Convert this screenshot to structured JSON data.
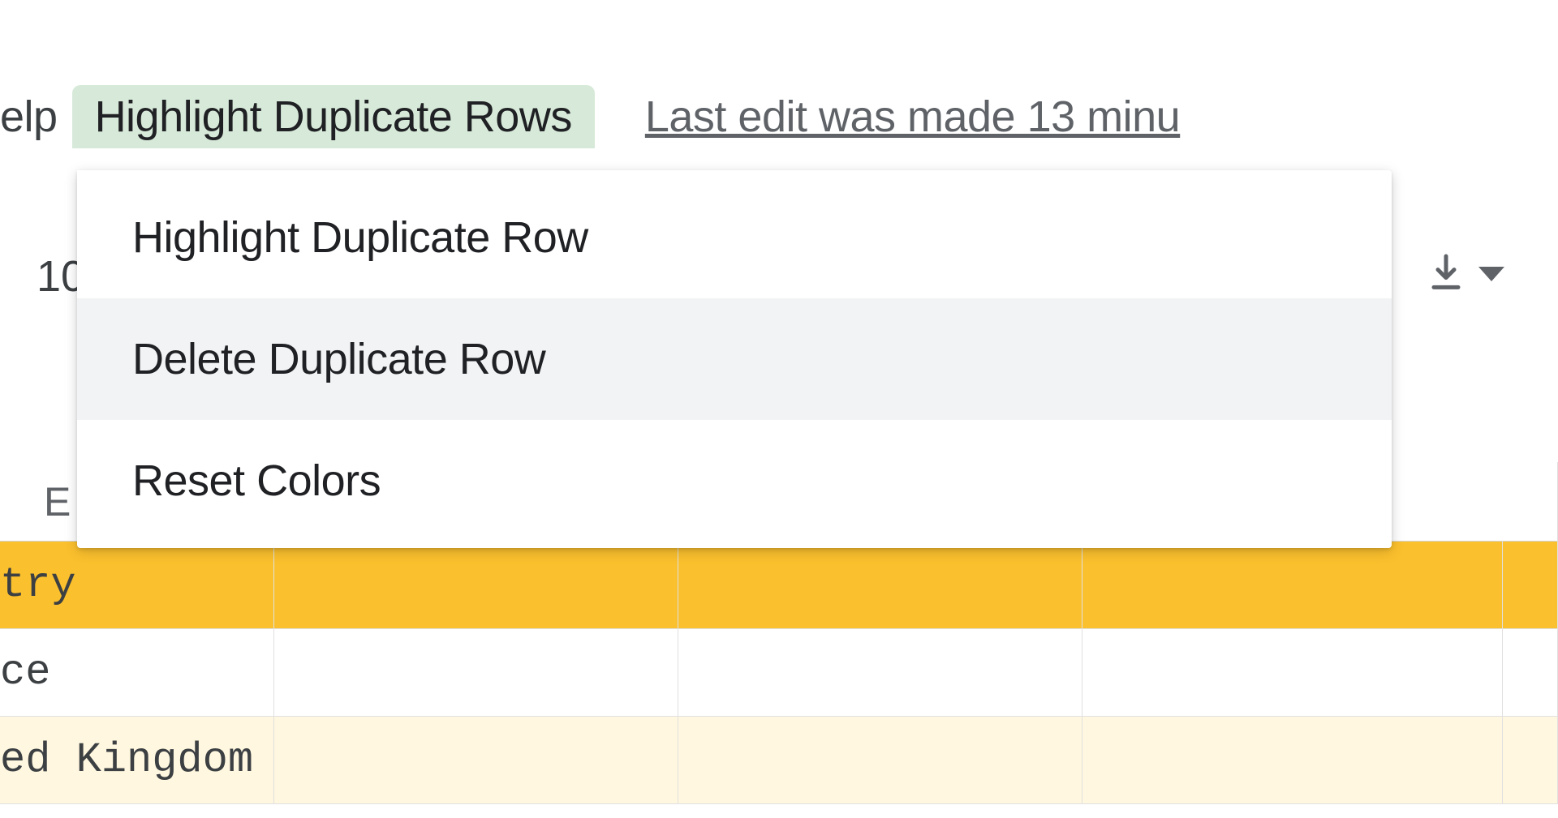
{
  "menubar": {
    "help_label": "elp",
    "highlight_menu_label": "Highlight Duplicate Rows",
    "last_edit_text": "Last edit was made 13 minu"
  },
  "toolbar": {
    "value_peek": "10"
  },
  "dropdown": {
    "items": [
      {
        "label": "Highlight Duplicate Row"
      },
      {
        "label": "Delete Duplicate Row"
      },
      {
        "label": "Reset Colors"
      }
    ]
  },
  "sheet": {
    "column_header_e": "E",
    "rows": [
      {
        "bg": "yellow-strong",
        "cell0": "try"
      },
      {
        "bg": "white",
        "cell0": "ce"
      },
      {
        "bg": "yellow-light",
        "cell0": "ed Kingdom"
      }
    ]
  }
}
